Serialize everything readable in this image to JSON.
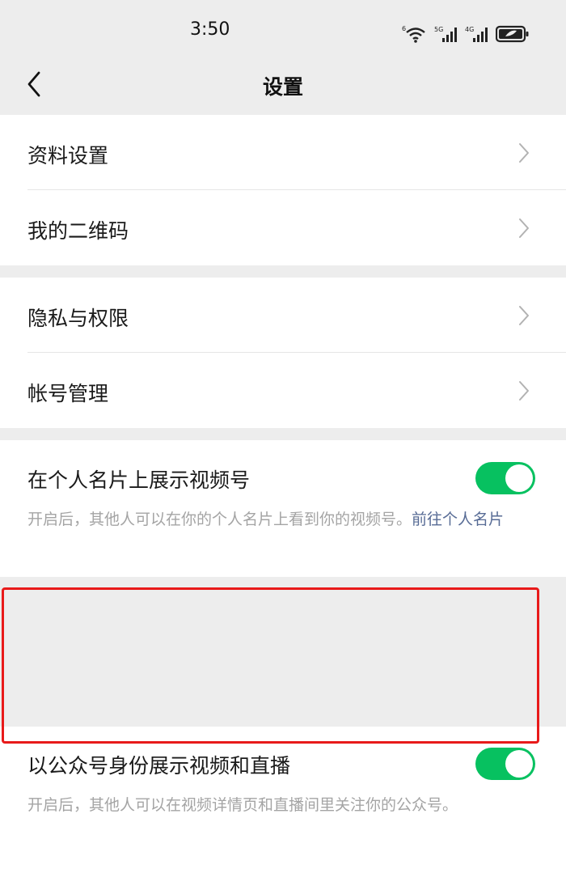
{
  "status_bar": {
    "time": "3:50",
    "icons": [
      "wifi-icon",
      "signal-5g-icon",
      "signal-4g-icon",
      "battery-icon"
    ],
    "wifi_label": "6",
    "sim1_label": "5G",
    "sim2_label": "4G"
  },
  "nav": {
    "title": "设置",
    "back_icon": "chevron-left-icon"
  },
  "groups": [
    {
      "items": [
        {
          "label": "资料设置"
        },
        {
          "label": "我的二维码"
        }
      ]
    },
    {
      "items": [
        {
          "label": "隐私与权限"
        },
        {
          "label": "帐号管理"
        }
      ]
    }
  ],
  "toggles": [
    {
      "title": "在个人名片上展示视频号",
      "enabled": true,
      "description": "开启后，其他人可以在你的个人名片上看到你的视频号。",
      "link": "前往个人名片"
    },
    {
      "title": "以公众号身份展示视频和直播",
      "enabled": true,
      "description": "开启后，其他人可以在视频详情页和直播间里关注你的公众号。"
    }
  ],
  "colors": {
    "background": "#ededed",
    "card": "#ffffff",
    "switch_on": "#07c160",
    "link": "#576b95",
    "highlight": "#e81a1a"
  }
}
